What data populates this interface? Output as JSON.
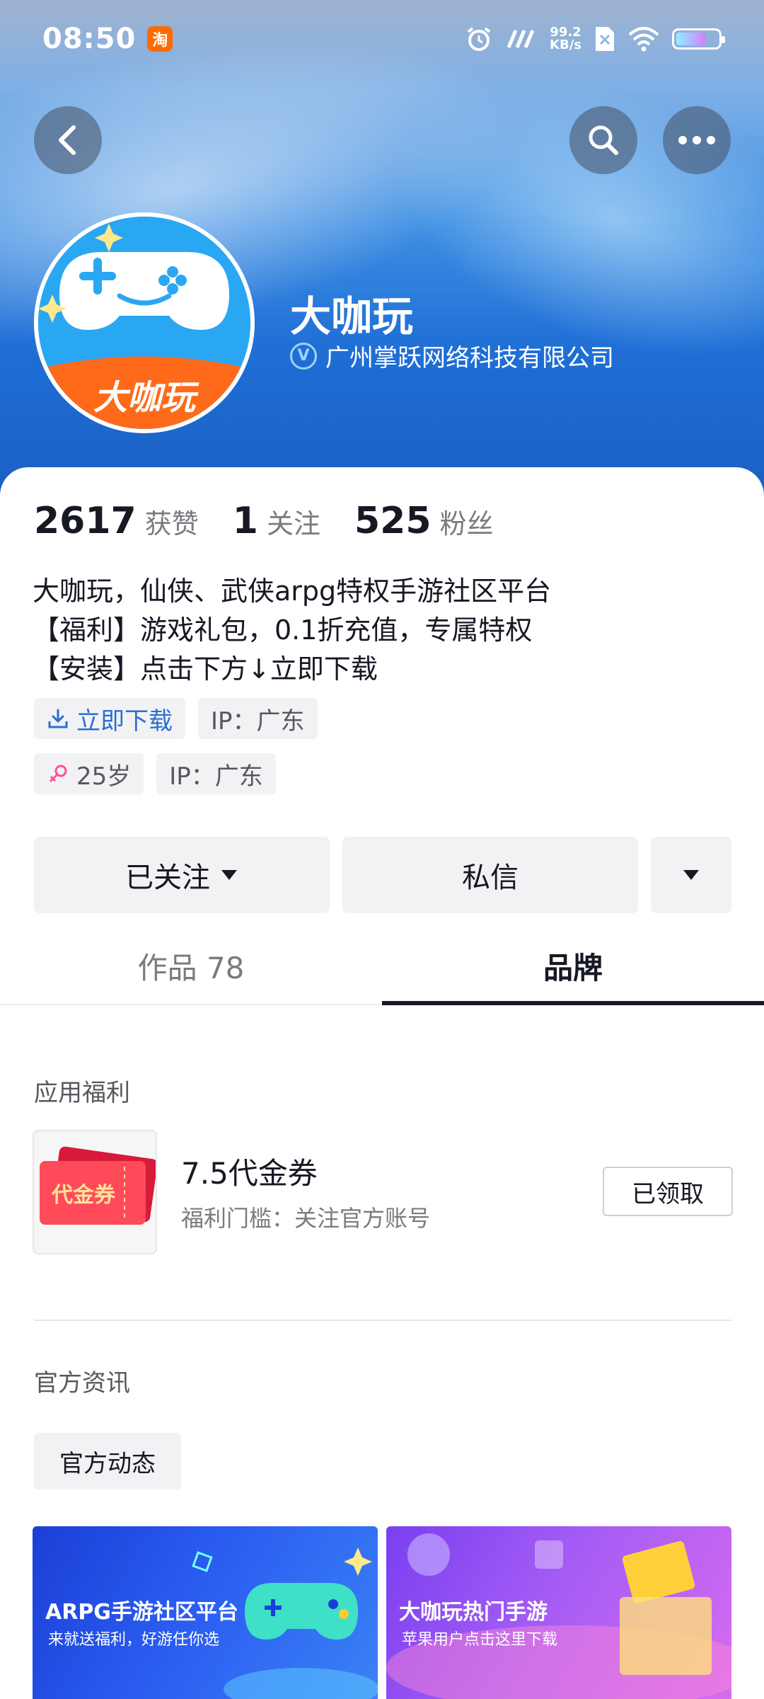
{
  "status_bar": {
    "time": "08:50",
    "app_badge": "淘",
    "net_speed_value": "99.2",
    "net_speed_unit": "KB/s"
  },
  "header": {
    "back_icon": "chevron-left-icon",
    "search_icon": "search-icon",
    "more_icon": "more-horizontal-icon"
  },
  "profile": {
    "name": "大咖玩",
    "company": "广州掌跃网络科技有限公司",
    "avatar_text": "大咖玩",
    "verify_icon": "verified-v-icon"
  },
  "stats": [
    {
      "number": "2617",
      "label": "获赞"
    },
    {
      "number": "1",
      "label": "关注"
    },
    {
      "number": "525",
      "label": "粉丝"
    }
  ],
  "bio": {
    "line1": "大咖玩，仙侠、武侠arpg特权手游社区平台",
    "line2": "【福利】游戏礼包，0.1折充值，专属特权",
    "line3": "【安装】点击下方↓立即下载"
  },
  "tags_row1": {
    "download": "立即下载",
    "ip": "IP：广东"
  },
  "tags_row2": {
    "age": "25岁",
    "ip": "IP：广东"
  },
  "actions": {
    "followed": "已关注",
    "message": "私信"
  },
  "tabs": {
    "works": "作品 78",
    "brand": "品牌"
  },
  "benefits": {
    "section_title": "应用福利",
    "coupon_thumb_text": "代金券",
    "title": "7.5代金券",
    "subtitle": "福利门槛：关注官方账号",
    "claimed_label": "已领取"
  },
  "news": {
    "section_title": "官方资讯",
    "chip": "官方动态"
  },
  "banners": [
    {
      "title": "ARPG手游社区平台",
      "subtitle": "来就送福利，好游任你选"
    },
    {
      "title": "大咖玩热门手游",
      "subtitle": "苹果用户点击这里下载"
    }
  ],
  "colors": {
    "accent_blue": "#2b6fd1",
    "tag_bg": "#f2f2f4",
    "text_primary": "#161823",
    "text_secondary": "#7a7b80"
  }
}
